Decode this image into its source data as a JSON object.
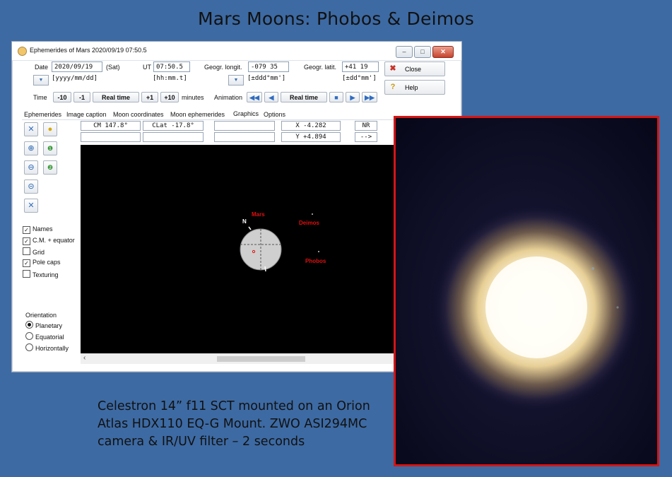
{
  "slide": {
    "title": "Mars Moons:   Phobos & Deimos",
    "caption": [
      "Celestron 14” f11 SCT mounted on an Orion",
      "Atlas HDX110 EQ-G Mount.  ZWO ASI294MC",
      "camera & IR/UV filter – 2 seconds"
    ]
  },
  "window": {
    "title": "Ephemerides of Mars  2020/09/19  07:50.5",
    "controls": {
      "minimize": "–",
      "maximize": "□",
      "close": "✕"
    }
  },
  "form": {
    "date_label": "Date",
    "date_value": "2020/09/19",
    "date_day": "(Sat)",
    "date_format": "[yyyy/mm/dd]",
    "ut_label": "UT",
    "ut_value": "07:50.5",
    "ut_format": "[hh:mm.t]",
    "longit_label": "Geogr. longit.",
    "longit_value": "-079 35",
    "longit_format": "[±ddd°mm']",
    "latit_label": "Geogr. latit.",
    "latit_value": "+41 19",
    "latit_format": "[±dd°mm']"
  },
  "buttons": {
    "close": "Close",
    "help": "Help"
  },
  "time_row": {
    "label": "Time",
    "minus10": "-10",
    "minus1": "-1",
    "realtime": "Real time",
    "plus1": "+1",
    "plus10": "+10",
    "units": "minutes",
    "animation_label": "Animation",
    "anim_realtime": "Real time"
  },
  "tabs": [
    "Ephemerides",
    "Image caption",
    "Moon coordinates",
    "Moon ephemerides",
    "Graphics",
    "Options"
  ],
  "info": {
    "cm": "CM  147.8°",
    "clat": "CLat -17.8°",
    "x": "X   -4.282",
    "y": "Y   +4.894",
    "nr": "NR",
    "arrow": "-->"
  },
  "options": {
    "names": "Names",
    "cm_equator": "C.M. + equator",
    "grid": "Grid",
    "pole_caps": "Pole caps",
    "texturing": "Texturing"
  },
  "orientation": {
    "label": "Orientation",
    "planetary": "Planetary",
    "equatorial": "Equatorial",
    "horizontally": "Horizontally"
  },
  "graphic_labels": {
    "mars": "Mars",
    "deimos": "Deimos",
    "phobos": "Phobos",
    "north": "N"
  },
  "colors": {
    "label_red": "#e01010",
    "frame_red": "#d41616",
    "slide_bg": "#3d6aa3"
  }
}
